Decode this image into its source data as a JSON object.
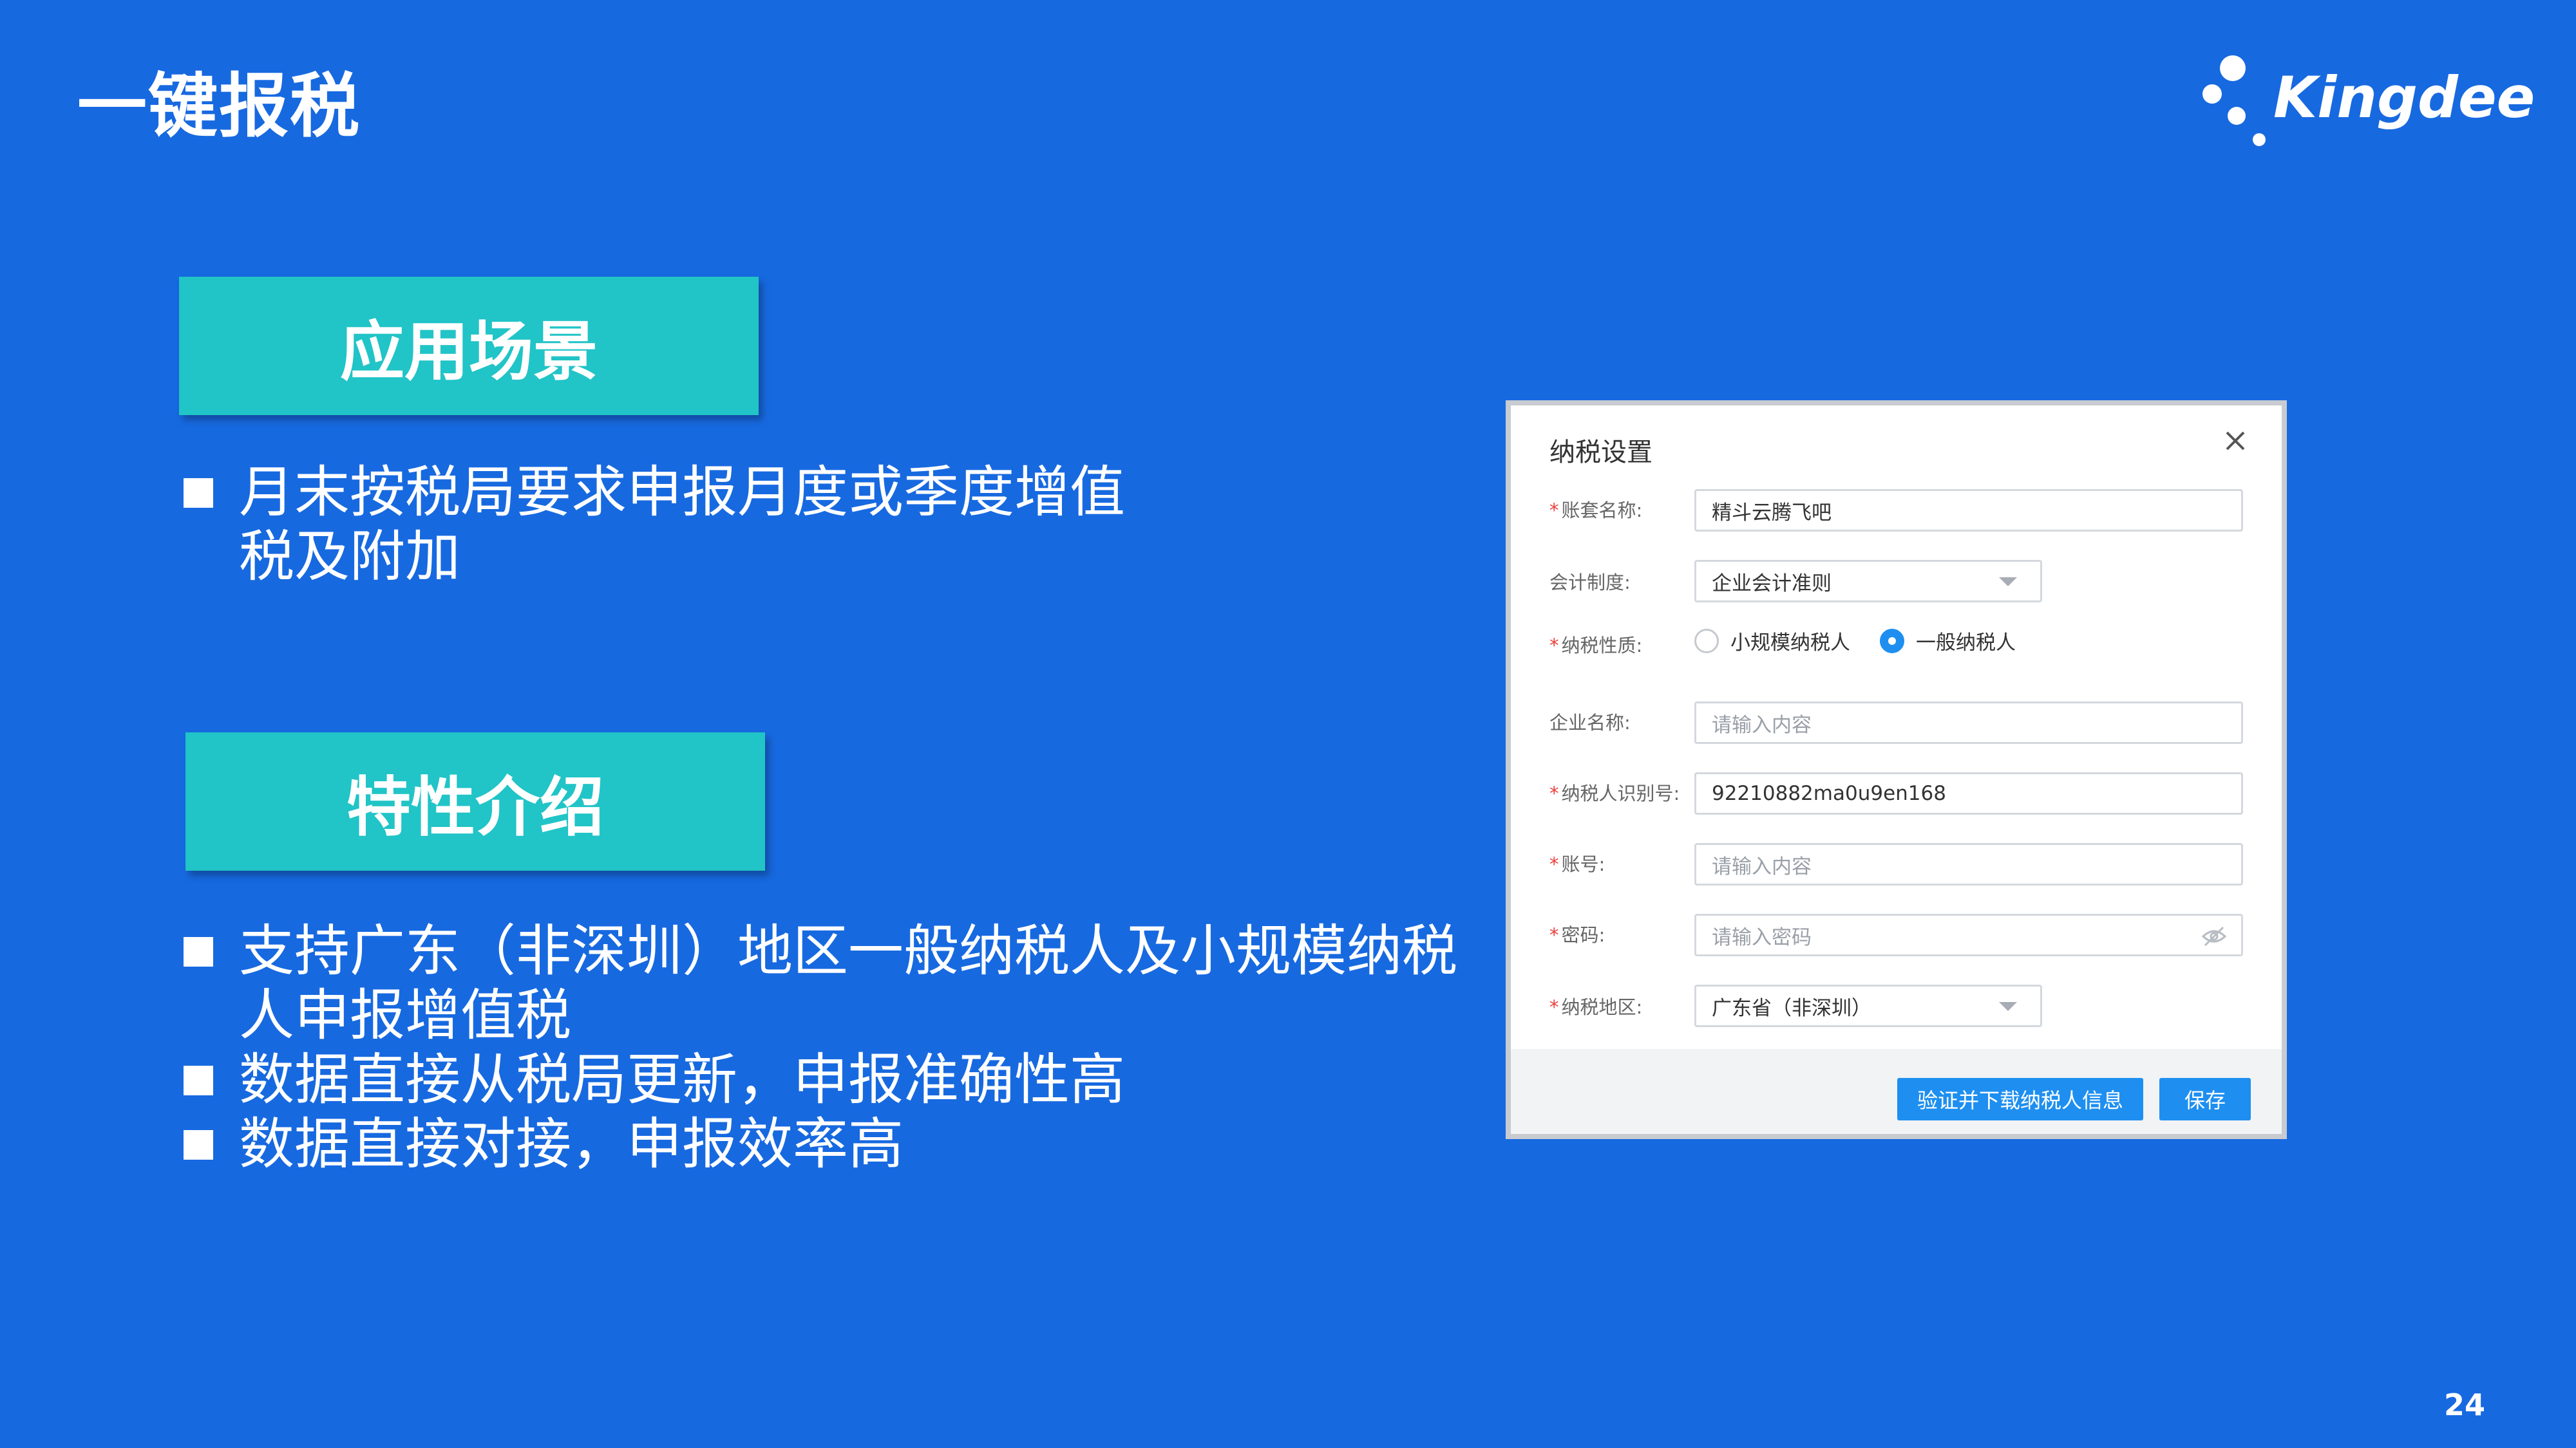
{
  "slide": {
    "title": "一键报税",
    "page_number": "24"
  },
  "logo": {
    "text": "Kingdee",
    "icon": "kingdee-dots-logo"
  },
  "sections": [
    {
      "heading": "应用场景",
      "bullets": [
        "月末按税局要求申报月度或季度增值税及附加"
      ]
    },
    {
      "heading": "特性介绍",
      "bullets": [
        "支持广东（非深圳）地区一般纳税人及小规模纳税人申报增值税",
        "数据直接从税局更新，申报准确性高",
        "数据直接对接，申报效率高"
      ]
    }
  ],
  "dialog": {
    "title": "纳税设置",
    "close_icon": "close-icon",
    "required_mark": "*",
    "fields": {
      "account_set": {
        "label": "账套名称:",
        "value": "精斗云腾飞吧"
      },
      "accounting_system": {
        "label": "会计制度:",
        "value": "企业会计准则"
      },
      "taxpayer_type": {
        "label": "纳税性质:",
        "options": [
          "小规模纳税人",
          "一般纳税人"
        ],
        "selected": "一般纳税人"
      },
      "company_name": {
        "label": "企业名称:",
        "placeholder": "请输入内容"
      },
      "taxpayer_id": {
        "label": "纳税人识别号:",
        "value": "92210882ma0u9en168"
      },
      "account": {
        "label": "账号:",
        "placeholder": "请输入内容"
      },
      "password": {
        "label": "密码:",
        "placeholder": "请输入密码",
        "icon": "eye-off-icon"
      },
      "tax_region": {
        "label": "纳税地区:",
        "value": "广东省（非深圳）"
      }
    },
    "buttons": {
      "verify": "验证并下载纳税人信息",
      "save": "保存"
    }
  },
  "colors": {
    "background": "#1769e0",
    "section_box": "#21c4c7",
    "primary_button": "#1e8ff0",
    "required": "#e8413b"
  }
}
